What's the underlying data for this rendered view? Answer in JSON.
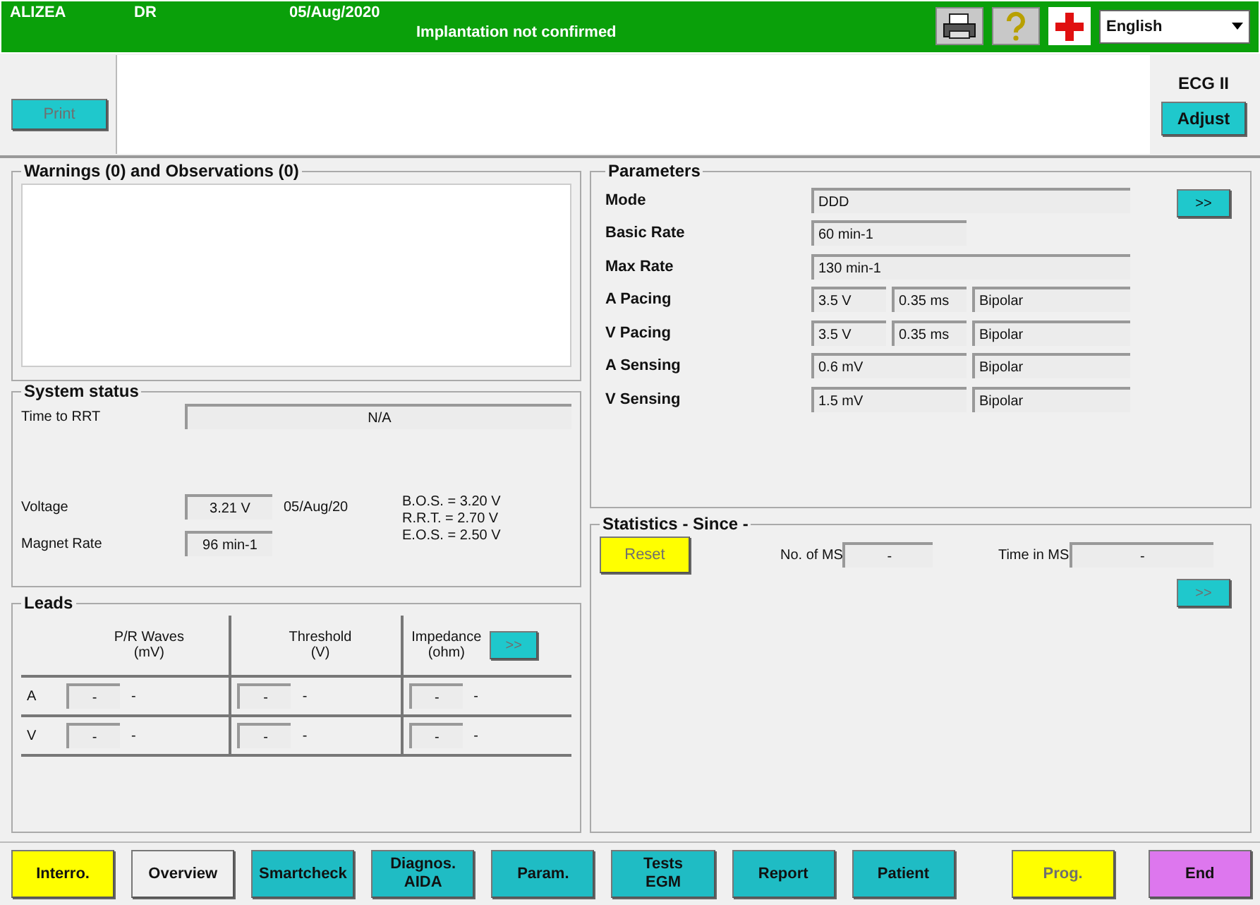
{
  "header": {
    "device": "ALIZEA",
    "model": "DR",
    "date": "05/Aug/2020",
    "status": "Implantation not confirmed",
    "language": "English"
  },
  "toolbar": {
    "print": {
      "label": "Print",
      "disabled": true
    },
    "ecg_lead": "ECG II",
    "adjust": {
      "label": "Adjust",
      "disabled": false
    }
  },
  "warnings": {
    "title": "Warnings (0) and Observations (0)"
  },
  "system_status": {
    "title": "System status",
    "time_to_rrt": {
      "label": "Time to RRT",
      "value": "N/A"
    },
    "voltage": {
      "label": "Voltage",
      "value": "3.21 V",
      "date": "05/Aug/20",
      "thresholds": [
        "B.O.S. = 3.20 V",
        "R.R.T. = 2.70 V",
        "E.O.S. = 2.50 V"
      ]
    },
    "magnet_rate": {
      "label": "Magnet Rate",
      "value": "96 min-1"
    }
  },
  "leads": {
    "title": "Leads",
    "more": {
      "label": ">>",
      "disabled": true
    },
    "columns": [
      {
        "label": "P/R Waves",
        "unit": "(mV)"
      },
      {
        "label": "Threshold",
        "unit": "(V)"
      },
      {
        "label": "Impedance",
        "unit": "(ohm)"
      }
    ],
    "rows": [
      {
        "label": "A",
        "cells": [
          {
            "value": "-",
            "note": "-"
          },
          {
            "value": "-",
            "note": "-"
          },
          {
            "value": "-",
            "note": "-"
          }
        ]
      },
      {
        "label": "V",
        "cells": [
          {
            "value": "-",
            "note": "-"
          },
          {
            "value": "-",
            "note": "-"
          },
          {
            "value": "-",
            "note": "-"
          }
        ]
      }
    ]
  },
  "parameters": {
    "title": "Parameters",
    "more": {
      "label": ">>",
      "disabled": false
    },
    "rows": [
      {
        "label": "Mode",
        "fields": [
          {
            "value": "DDD",
            "kind": "full"
          }
        ]
      },
      {
        "label": "Basic Rate",
        "fields": [
          {
            "value": "60 min-1",
            "kind": "double"
          }
        ]
      },
      {
        "label": "Max Rate",
        "fields": [
          {
            "value": "130 min-1",
            "kind": "full"
          }
        ]
      },
      {
        "label": "A Pacing",
        "fields": [
          {
            "value": "3.5 V",
            "kind": "single"
          },
          {
            "value": "0.35 ms",
            "kind": "single"
          },
          {
            "value": "Bipolar",
            "kind": "double"
          }
        ]
      },
      {
        "label": "V Pacing",
        "fields": [
          {
            "value": "3.5 V",
            "kind": "single"
          },
          {
            "value": "0.35 ms",
            "kind": "single"
          },
          {
            "value": "Bipolar",
            "kind": "double"
          }
        ]
      },
      {
        "label": "A Sensing",
        "fields": [
          {
            "value": "0.6 mV",
            "kind": "double"
          },
          {
            "value": "Bipolar",
            "kind": "double"
          }
        ]
      },
      {
        "label": "V Sensing",
        "fields": [
          {
            "value": "1.5 mV",
            "kind": "double"
          },
          {
            "value": "Bipolar",
            "kind": "double"
          }
        ]
      }
    ]
  },
  "statistics": {
    "title": "Statistics - Since -",
    "reset": {
      "label": "Reset",
      "disabled": true
    },
    "count": {
      "label": "No. of MS",
      "value": "-"
    },
    "time": {
      "label": "Time in MS",
      "value": "-"
    },
    "more": {
      "label": ">>",
      "disabled": true
    }
  },
  "nav": [
    {
      "label": "Interro.",
      "color": "#ffff00",
      "disabled": false
    },
    {
      "label": "Overview",
      "color": "#f0f0f0",
      "disabled": false
    },
    {
      "label": "Smartcheck",
      "color": "#1fbcc4",
      "disabled": false
    },
    {
      "label": "Diagnos.\nAIDA",
      "color": "#1fbcc4",
      "disabled": false
    },
    {
      "label": "Param.",
      "color": "#1fbcc4",
      "disabled": false
    },
    {
      "label": "Tests\nEGM",
      "color": "#1fbcc4",
      "disabled": false
    },
    {
      "label": "Report",
      "color": "#1fbcc4",
      "disabled": false
    },
    {
      "label": "Patient",
      "color": "#1fbcc4",
      "disabled": false
    },
    {
      "label": "Prog.",
      "color": "#ffff00",
      "disabled": true
    },
    {
      "label": "End",
      "color": "#dd77ee",
      "disabled": false
    }
  ]
}
